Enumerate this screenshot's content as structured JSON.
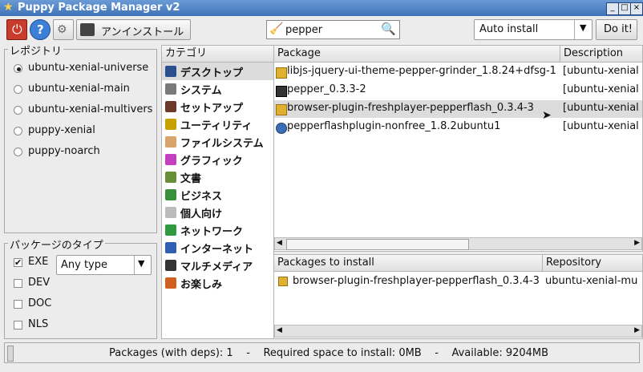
{
  "window": {
    "title": "Puppy Package Manager v2"
  },
  "toolbar": {
    "uninstall_label": "アンインストール",
    "search_value": "pepper",
    "install_mode": "Auto install",
    "doit_label": "Do it!"
  },
  "repositories": {
    "legend": "レポジトリ",
    "items": [
      "ubuntu-xenial-universe",
      "ubuntu-xenial-main",
      "ubuntu-xenial-multivers",
      "puppy-xenial",
      "puppy-noarch"
    ],
    "selected": "ubuntu-xenial-universe"
  },
  "package_types": {
    "legend": "パッケージのタイプ",
    "types": [
      {
        "label": "EXE",
        "checked": true
      },
      {
        "label": "DEV",
        "checked": false
      },
      {
        "label": "DOC",
        "checked": false
      },
      {
        "label": "NLS",
        "checked": false
      }
    ],
    "filter_value": "Any type"
  },
  "categories": {
    "header": "カテゴリ",
    "items": [
      {
        "label": "デスクトップ",
        "icon": "desktop-icon",
        "color": "#2a4f8f"
      },
      {
        "label": "システム",
        "icon": "system-icon",
        "color": "#7a7a7a"
      },
      {
        "label": "セットアップ",
        "icon": "setup-icon",
        "color": "#6b3a2a"
      },
      {
        "label": "ユーティリティ",
        "icon": "utility-icon",
        "color": "#c8a000"
      },
      {
        "label": "ファイルシステム",
        "icon": "folder-icon",
        "color": "#d9a46a"
      },
      {
        "label": "グラフィック",
        "icon": "graphic-icon",
        "color": "#c23fbf"
      },
      {
        "label": "文書",
        "icon": "document-icon",
        "color": "#6a8f3a"
      },
      {
        "label": "ビジネス",
        "icon": "business-icon",
        "color": "#3a8f3a"
      },
      {
        "label": "個人向け",
        "icon": "calendar-icon",
        "color": "#bbbbbb"
      },
      {
        "label": "ネットワーク",
        "icon": "network-icon",
        "color": "#2f9a3f"
      },
      {
        "label": "インターネット",
        "icon": "internet-icon",
        "color": "#2e5fb0"
      },
      {
        "label": "マルチメディア",
        "icon": "multimedia-icon",
        "color": "#333333"
      },
      {
        "label": "お楽しみ",
        "icon": "fun-icon",
        "color": "#d06020"
      }
    ],
    "selected": "デスクトップ"
  },
  "packages": {
    "col_package": "Package",
    "col_description": "Description",
    "rows": [
      {
        "name": "libjs-jquery-ui-theme-pepper-grinder_1.8.24+dfsg-1",
        "description": "[ubuntu-xenial",
        "icon": "package-icon"
      },
      {
        "name": "pepper_0.3.3-2",
        "description": "[ubuntu-xenial",
        "icon": "terminal-icon"
      },
      {
        "name": "browser-plugin-freshplayer-pepperflash_0.3.4-3",
        "description": "[ubuntu-xenial",
        "icon": "package-icon"
      },
      {
        "name": "pepperflashplugin-nonfree_1.8.2ubuntu1",
        "description": "[ubuntu-xenial",
        "icon": "globe-icon"
      }
    ],
    "selected_index": 2
  },
  "install_list": {
    "col_package": "Packages to install",
    "col_repository": "Repository",
    "rows": [
      {
        "name": "browser-plugin-freshplayer-pepperflash_0.3.4-3",
        "repository": "ubuntu-xenial-mu",
        "icon": "package-icon"
      }
    ]
  },
  "status": {
    "text": "Packages (with deps): 1    -    Required space to install: 0MB    -    Available: 9204MB"
  }
}
